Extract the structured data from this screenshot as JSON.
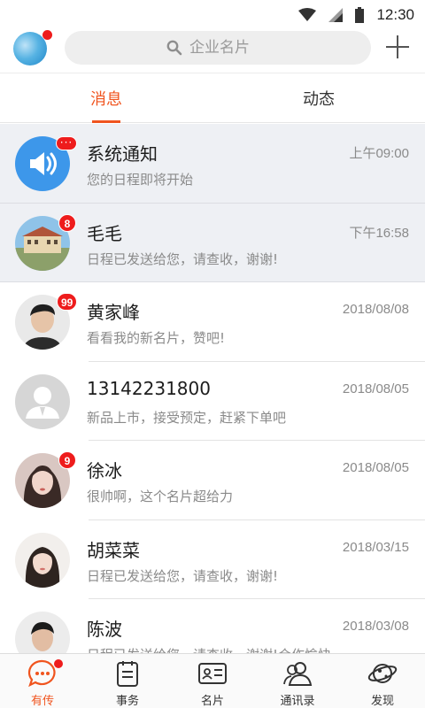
{
  "status_bar": {
    "time": "12:30"
  },
  "header": {
    "search_placeholder": "企业名片"
  },
  "tabs": [
    {
      "label": "消息",
      "active": true
    },
    {
      "label": "动态",
      "active": false
    }
  ],
  "messages": [
    {
      "name": "系统通知",
      "time": "上午09:00",
      "preview": "您的日程即将开始",
      "badge": "···",
      "avatar": "speaker-icon"
    },
    {
      "name": "毛毛",
      "time": "下午16:58",
      "preview": "日程已发送给您，请查收，谢谢!",
      "badge": "8",
      "avatar": "building-photo"
    },
    {
      "name": "黄家峰",
      "time": "2018/08/08",
      "preview": "看看我的新名片，赞吧!",
      "badge": "99",
      "avatar": "man-photo"
    },
    {
      "name": "13142231800",
      "time": "2018/08/05",
      "preview": "新品上市，接受预定，赶紧下单吧",
      "badge": "",
      "avatar": "default-person-icon"
    },
    {
      "name": "徐冰",
      "time": "2018/08/05",
      "preview": "很帅啊，这个名片超给力",
      "badge": "9",
      "avatar": "woman-photo"
    },
    {
      "name": "胡菜菜",
      "time": "2018/03/15",
      "preview": "日程已发送给您，请查收，谢谢!",
      "badge": "",
      "avatar": "girl-photo"
    },
    {
      "name": "陈波",
      "time": "2018/03/08",
      "preview": "日程已发送给您，请查收，谢谢!合作愉快",
      "badge": "",
      "avatar": "young-man-photo"
    }
  ],
  "bottom_nav": [
    {
      "label": "有传",
      "active": true,
      "icon": "chat-bubble-icon"
    },
    {
      "label": "事务",
      "active": false,
      "icon": "clipboard-icon"
    },
    {
      "label": "名片",
      "active": false,
      "icon": "business-card-icon"
    },
    {
      "label": "通讯录",
      "active": false,
      "icon": "contacts-icon"
    },
    {
      "label": "发现",
      "active": false,
      "icon": "planet-icon"
    }
  ],
  "colors": {
    "accent": "#f0541e",
    "badge": "#ee1c1c",
    "highlight_row": "#eef0f4"
  }
}
